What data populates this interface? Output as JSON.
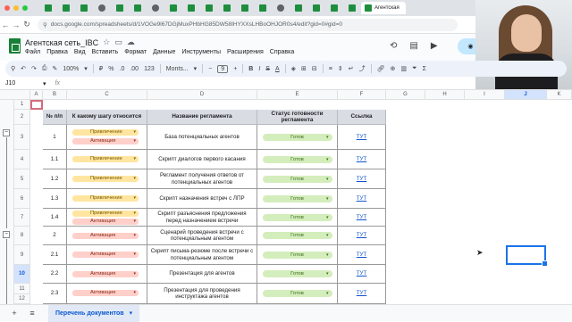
{
  "browser": {
    "active_tab_title": "Агентская",
    "url": "docs.google.com/spreadsheets/d/1VOGe9l67DGjMuxPHbHG85DW58IHYXXsLHBoOHJOR0s4/edit?gid=0#gid=0"
  },
  "doc": {
    "title": "Агентская сеть_IBC",
    "menus": [
      "Файл",
      "Правка",
      "Вид",
      "Вставить",
      "Формат",
      "Данные",
      "Инструменты",
      "Расширения",
      "Справка"
    ],
    "share_label": "Н"
  },
  "toolbar": {
    "zoom": "100%",
    "currency": "₽",
    "percent": "%",
    "dec_less": ".0",
    "dec_more": ".00",
    "num_format": "123",
    "font": "Monts...",
    "font_size": "9",
    "bold": "B",
    "italic": "I",
    "strike": "S",
    "text_color": "A"
  },
  "formula_bar": {
    "cell_ref": "J10",
    "fx": "fx",
    "content": ""
  },
  "columns": [
    "A",
    "B",
    "C",
    "D",
    "E",
    "F",
    "G",
    "H",
    "I",
    "J",
    "K"
  ],
  "rows": [
    "1",
    "2",
    "3",
    "4",
    "5",
    "6",
    "7",
    "8",
    "9",
    "10",
    "11",
    "12"
  ],
  "selected_col": "J",
  "selected_row": "10",
  "table": {
    "headers": [
      "№ п/п",
      "К какому шагу относится",
      "Название регламента",
      "Статус готовности регламента",
      "Ссылка"
    ],
    "rows": [
      {
        "num": "1",
        "steps": [
          "Привлечение",
          "Активация"
        ],
        "name": "База потенциальных агентов",
        "status": "Готов",
        "link": "ТУТ"
      },
      {
        "num": "1.1",
        "steps": [
          "Привлечение"
        ],
        "name": "Скрипт диалогов первого касания",
        "status": "Готов",
        "link": "ТУТ"
      },
      {
        "num": "1.2",
        "steps": [
          "Привлечение"
        ],
        "name": "Регламент получения ответов от потенциальных агентов",
        "status": "Готов",
        "link": "ТУТ"
      },
      {
        "num": "1.3",
        "steps": [
          "Привлечение"
        ],
        "name": "Скрипт назначения встреч с ЛПР",
        "status": "Готов",
        "link": "ТУТ"
      },
      {
        "num": "1.4",
        "steps": [
          "Привлечение",
          "Активация"
        ],
        "name": "Скрипт разъяснения предложения перед назначением встречи",
        "status": "Готов",
        "link": "ТУТ"
      },
      {
        "num": "2",
        "steps": [
          "Активация"
        ],
        "name": "Сценарий проведения встречи с потенциальным агентом",
        "status": "Готов",
        "link": "ТУТ"
      },
      {
        "num": "2.1",
        "steps": [
          "Активация"
        ],
        "name": "Скрипт письма-резюме после встречи с потенциальным агентом",
        "status": "Готов",
        "link": "ТУТ"
      },
      {
        "num": "2.2",
        "steps": [
          "Активация"
        ],
        "name": "Презентация для агентов",
        "status": "Готов",
        "link": "ТУТ"
      },
      {
        "num": "2.3",
        "steps": [
          "Активация"
        ],
        "name": "Презентация для проведения инструктажа агентов",
        "status": "Готов",
        "link": "ТУТ"
      }
    ]
  },
  "sheet_tab": "Перечень документов",
  "colors": {
    "accent": "#1a73e8",
    "sheets_green": "#188038",
    "status_green": "#d4edbc",
    "chip_yellow": "#ffe5a0",
    "chip_red": "#ffcfc9"
  }
}
